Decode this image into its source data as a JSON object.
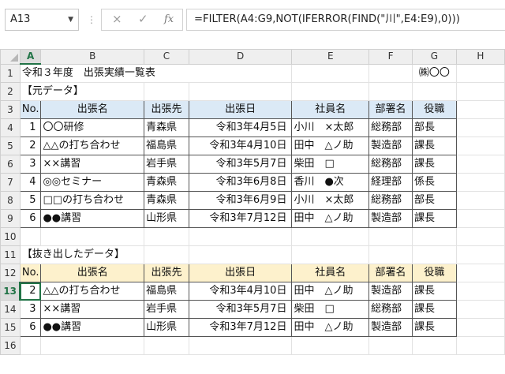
{
  "formula_bar": {
    "name_box": "A13",
    "cancel_icon": "×",
    "enter_icon": "✓",
    "fx_label": "fx",
    "formula": "=FILTER(A4:G9,NOT(IFERROR(FIND(\"川\",E4:E9),0)))"
  },
  "sheet": {
    "column_headers": [
      "A",
      "B",
      "C",
      "D",
      "E",
      "F",
      "G",
      "H"
    ],
    "row_headers": [
      "1",
      "2",
      "3",
      "4",
      "5",
      "6",
      "7",
      "8",
      "9",
      "10",
      "11",
      "12",
      "13",
      "14",
      "15",
      "16"
    ],
    "title": "令和３年度　出張実績一覧表",
    "company": "㈱〇〇",
    "section1_label": "【元データ】",
    "section2_label": "【抜き出したデータ】",
    "headers": [
      "No.",
      "出張名",
      "出張先",
      "出張日",
      "社員名",
      "部署名",
      "役職"
    ],
    "original": [
      [
        "1",
        "〇〇研修",
        "青森県",
        "令和3年4月5日",
        "小川　×太郎",
        "総務部",
        "部長"
      ],
      [
        "2",
        "△△の打ち合わせ",
        "福島県",
        "令和3年4月10日",
        "田中　△ノ助",
        "製造部",
        "課長"
      ],
      [
        "3",
        "××講習",
        "岩手県",
        "令和3年5月7日",
        "柴田　□",
        "総務部",
        "課長"
      ],
      [
        "4",
        "◎◎セミナー",
        "青森県",
        "令和3年6月8日",
        "香川　●次",
        "経理部",
        "係長"
      ],
      [
        "5",
        "□□の打ち合わせ",
        "青森県",
        "令和3年6月9日",
        "小川　×太郎",
        "総務部",
        "部長"
      ],
      [
        "6",
        "●●講習",
        "山形県",
        "令和3年7月12日",
        "田中　△ノ助",
        "製造部",
        "課長"
      ]
    ],
    "extracted": [
      [
        "2",
        "△△の打ち合わせ",
        "福島県",
        "令和3年4月10日",
        "田中　△ノ助",
        "製造部",
        "課長"
      ],
      [
        "3",
        "××講習",
        "岩手県",
        "令和3年5月7日",
        "柴田　□",
        "総務部",
        "課長"
      ],
      [
        "6",
        "●●講習",
        "山形県",
        "令和3年7月12日",
        "田中　△ノ助",
        "製造部",
        "課長"
      ]
    ]
  }
}
